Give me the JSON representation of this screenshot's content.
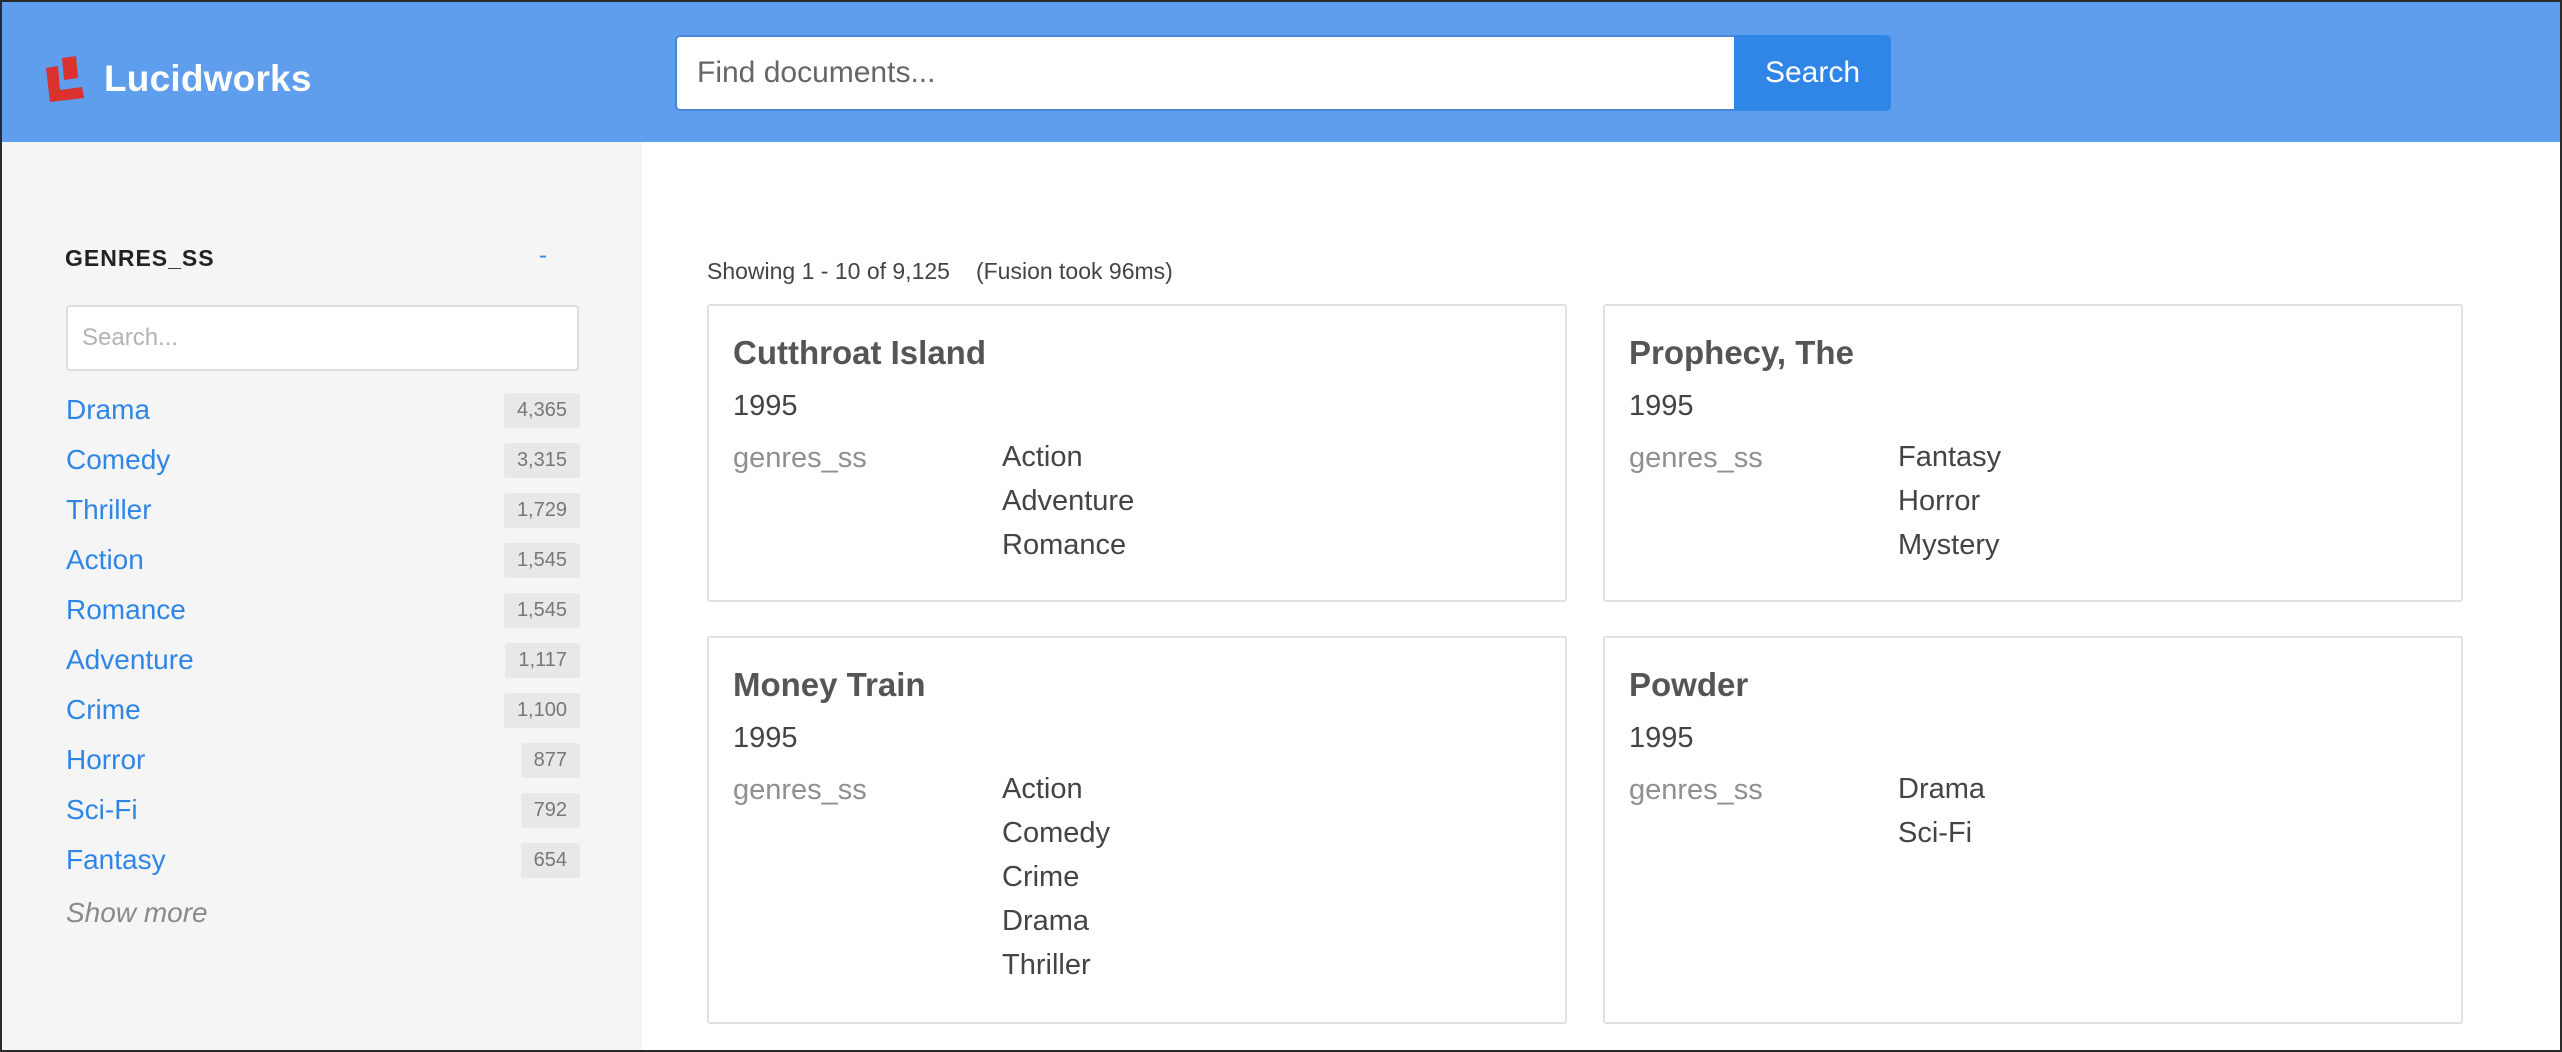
{
  "header": {
    "brand": "Lucidworks",
    "brand_color": "#5f9ded",
    "search_placeholder": "Find documents...",
    "search_button": "Search",
    "accent": "#2f86e6"
  },
  "sidebar": {
    "facet_title": "GENRES_SS",
    "collapse_label": "-",
    "facet_search_placeholder": "Search...",
    "items": [
      {
        "label": "Drama",
        "count": "4,365"
      },
      {
        "label": "Comedy",
        "count": "3,315"
      },
      {
        "label": "Thriller",
        "count": "1,729"
      },
      {
        "label": "Action",
        "count": "1,545"
      },
      {
        "label": "Romance",
        "count": "1,545"
      },
      {
        "label": "Adventure",
        "count": "1,117"
      },
      {
        "label": "Crime",
        "count": "1,100"
      },
      {
        "label": "Horror",
        "count": "877"
      },
      {
        "label": "Sci-Fi",
        "count": "792"
      },
      {
        "label": "Fantasy",
        "count": "654"
      }
    ],
    "show_more": "Show more"
  },
  "results": {
    "summary": "Showing 1 - 10 of 9,125",
    "timing": "(Fusion took 96ms)",
    "cards": [
      {
        "title": "Cutthroat Island",
        "year": "1995",
        "field": "genres_ss",
        "values": [
          "Action",
          "Adventure",
          "Romance"
        ]
      },
      {
        "title": "Prophecy, The",
        "year": "1995",
        "field": "genres_ss",
        "values": [
          "Fantasy",
          "Horror",
          "Mystery"
        ]
      },
      {
        "title": "Money Train",
        "year": "1995",
        "field": "genres_ss",
        "values": [
          "Action",
          "Comedy",
          "Crime",
          "Drama",
          "Thriller"
        ]
      },
      {
        "title": "Powder",
        "year": "1995",
        "field": "genres_ss",
        "values": [
          "Drama",
          "Sci-Fi"
        ]
      }
    ]
  }
}
